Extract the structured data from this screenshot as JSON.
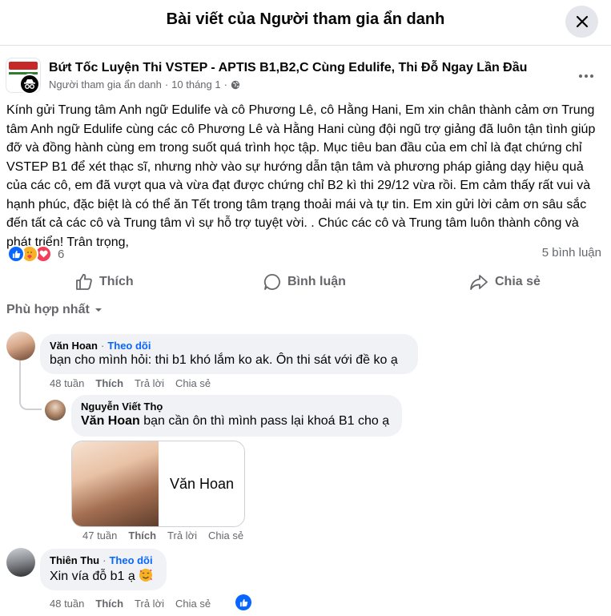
{
  "header": {
    "title": "Bài viết của Người tham gia ẩn danh"
  },
  "post": {
    "group_name": "Bứt Tốc Luyện Thi VSTEP - APTIS B1,B2,C Cùng Edulife, Thi Đỗ Ngay Lần Đầu",
    "author": "Người tham gia ẩn danh",
    "separator": "·",
    "date": "10 tháng 1",
    "separator2": "·",
    "text": "Kính gửi Trung tâm Anh ngữ Edulife và cô Phương Lê, cô Hằng Hani, Em xin chân thành cảm ơn Trung tâm Anh ngữ Edulife cùng các cô Phương Lê và Hằng Hani cùng đội ngũ trợ giảng đã luôn tận tình giúp đỡ và đồng hành cùng em trong suốt quá trình học tập. Mục tiêu ban đầu của em chỉ là đạt chứng chỉ VSTEP B1 để xét thạc sĩ, nhưng nhờ vào sự hướng dẫn tận tâm và phương pháp giảng dạy hiệu quả của các cô, em đã vượt qua và vừa đạt được chứng chỉ B2 kì thi 29/12 vừa rồi. Em cảm thấy rất vui và hạnh phúc, đặc biệt là có thể ăn Tết trong tâm trạng thoải mái và tự tin. Em xin gửi lời cảm ơn sâu sắc đến tất cả các cô và Trung tâm vì sự hỗ trợ tuyệt vời. . Chúc các cô và Trung tâm luôn thành công và phát triển! Trân trọng,",
    "reaction_count": "6",
    "comment_count": "5 bình luận",
    "reactions": [
      "like",
      "care",
      "love"
    ]
  },
  "actions": {
    "like": "Thích",
    "comment": "Bình luận",
    "share": "Chia sẻ"
  },
  "sort": {
    "label": "Phù hợp nhất"
  },
  "comments": [
    {
      "author": "Văn Hoan",
      "dot": "·",
      "follow": "Theo dõi",
      "text": "bạn cho mình hỏi: thi b1 khó lắm ko ak. Ôn thi sát với đề ko ạ",
      "time": "48 tuần",
      "like": "Thích",
      "reply": "Trả lời",
      "share": "Chia sẻ"
    },
    {
      "author": "Nguyễn Viết Thọ",
      "mention": "Văn Hoan",
      "text": "bạn cần ôn thì mình pass lại khoá B1 cho ạ",
      "card_name": "Văn Hoan",
      "time": "47 tuần",
      "like": "Thích",
      "reply": "Trả lời",
      "share": "Chia sẻ"
    },
    {
      "author": "Thiên Thu",
      "dot": "·",
      "follow": "Theo dõi",
      "text": "Xin vía đỗ b1 ạ",
      "time": "48 tuần",
      "like": "Thích",
      "reply": "Trả lời",
      "share": "Chia sẻ"
    }
  ],
  "colors": {
    "accent": "#0866ff",
    "muted": "#65676b",
    "bubble": "#f0f2f5",
    "love": "#f33e58",
    "care": "#f7b125"
  },
  "icons": {
    "close": "close-icon",
    "globe": "globe-icon",
    "more": "more-icon",
    "like": "thumbs-up-icon",
    "comment": "comment-icon",
    "share": "share-icon",
    "sort": "caret-down-icon"
  }
}
